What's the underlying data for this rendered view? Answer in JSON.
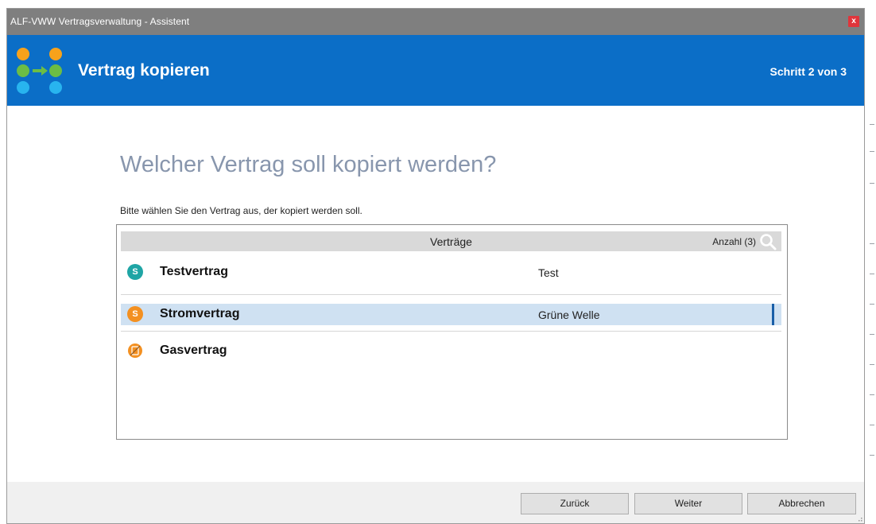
{
  "window": {
    "title": "ALF-VWW Vertragsverwaltung - Assistent",
    "close_label": "x"
  },
  "header": {
    "logo": "alf-logo",
    "heading": "Vertrag kopieren",
    "step": "Schritt 2 von 3"
  },
  "main": {
    "question": "Welcher Vertrag soll kopiert werden?",
    "instruction": "Bitte wählen Sie den Vertrag aus, der kopiert werden soll."
  },
  "list": {
    "title": "Verträge",
    "count": "Anzahl (3)",
    "search_icon": "search-icon",
    "rows": [
      {
        "name": "Testvertrag",
        "description": "Test",
        "icon": "strom-icon",
        "icon_letter": "S",
        "icon_color": "#1fa5a5",
        "selected": false
      },
      {
        "name": "Stromvertrag",
        "description": "Grüne Welle",
        "icon": "strom-icon",
        "icon_letter": "S",
        "icon_color": "#f39021",
        "selected": true
      },
      {
        "name": "Gasvertrag",
        "description": "",
        "icon": "gas-icon",
        "icon_letter": "",
        "icon_color": "#f39021",
        "selected": false
      }
    ]
  },
  "footer": {
    "back_label": "Zurück",
    "next_label": "Weiter",
    "cancel_label": "Abbrechen"
  },
  "colors": {
    "header_blue": "#0b6ec7",
    "titlebar_gray": "#7f7f7f",
    "question_color": "#8896ad",
    "selection": "#cfe1f2"
  }
}
